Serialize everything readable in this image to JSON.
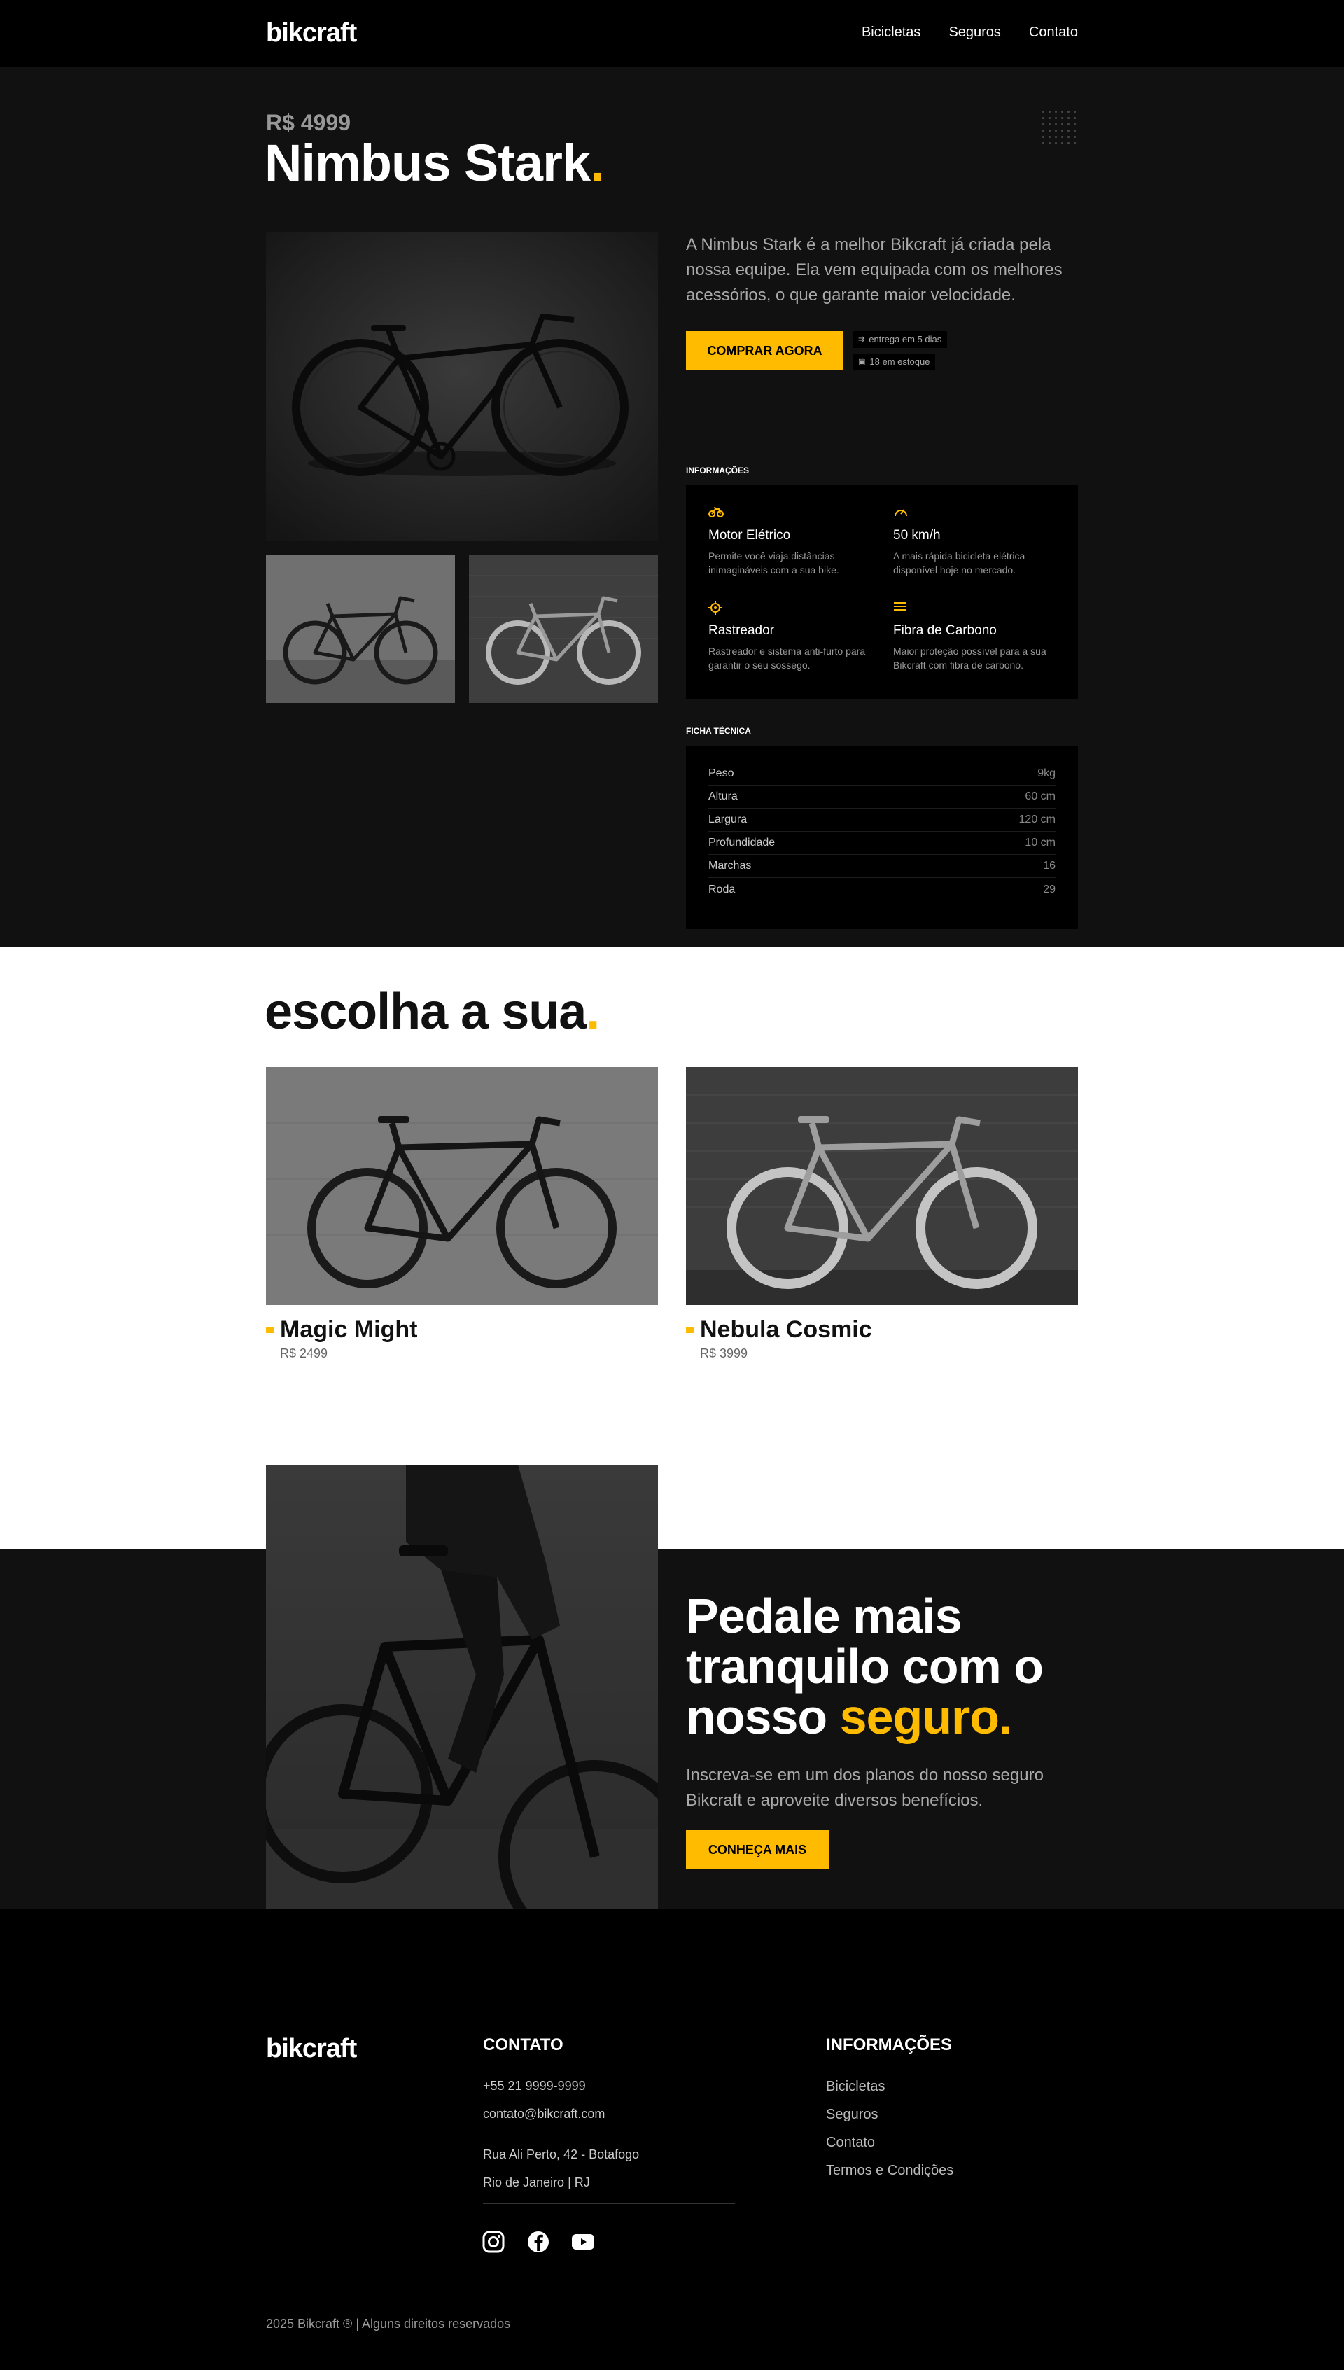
{
  "header": {
    "logo": "bikcraft",
    "nav": [
      "Bicicletas",
      "Seguros",
      "Contato"
    ]
  },
  "product": {
    "price": "R$ 4999",
    "title": "Nimbus Stark",
    "title_dot": ".",
    "description": "A Nimbus Stark é a melhor Bikcraft já criada pela nossa equipe. Ela vem equipada com os melhores acessórios, o que garante maior velocidade.",
    "buy_button": "Comprar Agora",
    "delivery_tag": "entrega em 5 dias",
    "stock_tag": "18 em estoque",
    "info_label": "Informações",
    "info": [
      {
        "icon": "bike-icon",
        "name": "Motor Elétrico",
        "text": "Permite você viaja distâncias inimagináveis com a sua bike."
      },
      {
        "icon": "speedometer-icon",
        "name": "50 km/h",
        "text": "A mais rápida bicicleta elétrica disponível hoje no mercado."
      },
      {
        "icon": "target-icon",
        "name": "Rastreador",
        "text": "Rastreador e sistema anti-furto para garantir o seu sossego."
      },
      {
        "icon": "layers-icon",
        "name": "Fibra de Carbono",
        "text": "Maior proteção possível para a sua Bikcraft com fibra de carbono."
      }
    ],
    "tech_label": "Ficha Técnica",
    "tech": [
      {
        "key": "Peso",
        "value": "9kg"
      },
      {
        "key": "Altura",
        "value": "60 cm"
      },
      {
        "key": "Largura",
        "value": "120 cm"
      },
      {
        "key": "Profundidade",
        "value": "10 cm"
      },
      {
        "key": "Marchas",
        "value": "16"
      },
      {
        "key": "Roda",
        "value": "29"
      }
    ]
  },
  "choose": {
    "title": "escolha a sua",
    "title_dot": ".",
    "bikes": [
      {
        "name": "Magic Might",
        "price": "R$ 2499"
      },
      {
        "name": "Nebula Cosmic",
        "price": "R$ 3999"
      }
    ]
  },
  "insurance": {
    "title_line1": "Pedale mais",
    "title_line2": "tranquilo com o",
    "title_line3_a": "nosso ",
    "title_line3_hl": "seguro.",
    "text": "Inscreva-se em um dos planos do nosso seguro Bikcraft e aproveite diversos benefícios.",
    "button": "Conheça Mais"
  },
  "footer": {
    "logo": "bikcraft",
    "contact_title": "Contato",
    "phone": "+55 21 9999-9999",
    "email": "contato@bikcraft.com",
    "address1": "Rua Ali Perto, 42 - Botafogo",
    "address2": "Rio de Janeiro | RJ",
    "socials": [
      "instagram-icon",
      "facebook-icon",
      "youtube-icon"
    ],
    "info_title": "Informações",
    "links": [
      "Bicicletas",
      "Seguros",
      "Contato",
      "Termos e Condições"
    ],
    "copyright": "2025 Bikcraft ® | Alguns direitos reservados"
  },
  "colors": {
    "accent": "#ffbb00",
    "dark": "#111111",
    "black": "#000000"
  }
}
